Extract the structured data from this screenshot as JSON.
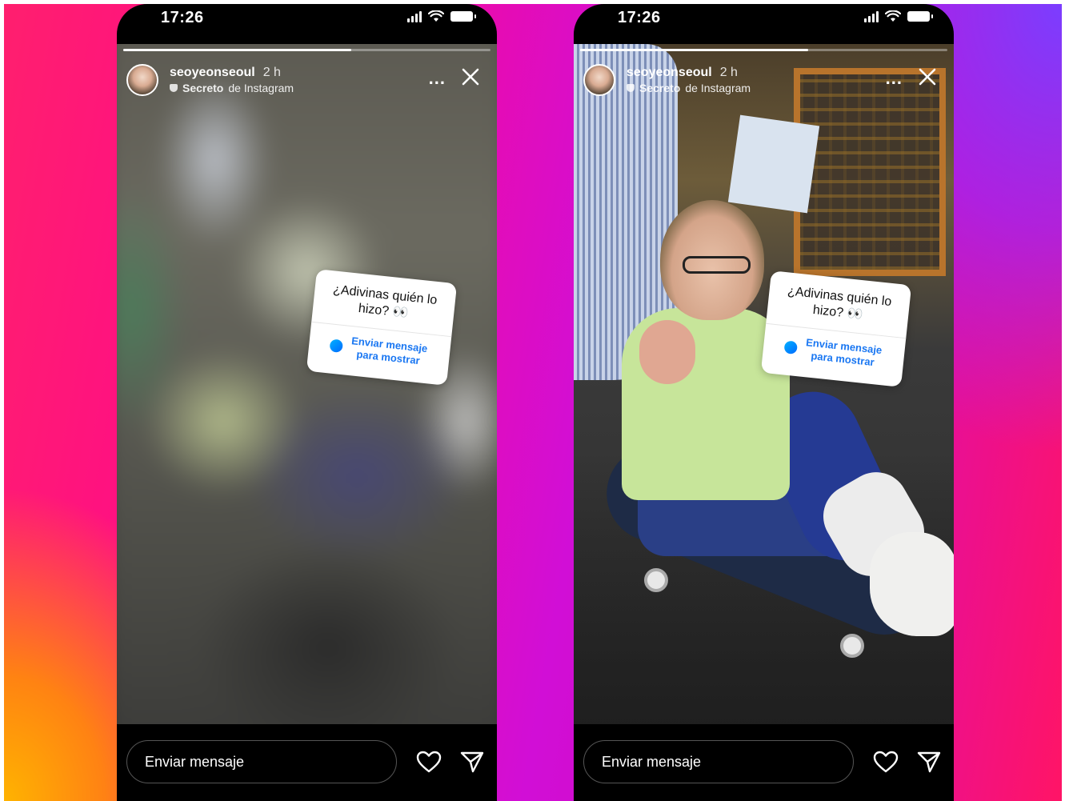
{
  "phones": [
    {
      "status_time": "17:26",
      "username": "seoyeonseoul",
      "time_ago": "2 h",
      "label_strong": "Secreto",
      "label_rest": "de Instagram",
      "more": "...",
      "sticker_question": "¿Adivinas quién lo hizo? 👀",
      "sticker_cta": "Enviar mensaje para mostrar",
      "message_placeholder": "Enviar mensaje",
      "progress": 0.62,
      "media_state": "blurred"
    },
    {
      "status_time": "17:26",
      "username": "seoyeonseoul",
      "time_ago": "2 h",
      "label_strong": "Secreto",
      "label_rest": "de Instagram",
      "more": "...",
      "sticker_question": "¿Adivinas quién lo hizo? 👀",
      "sticker_cta": "Enviar mensaje para mostrar",
      "message_placeholder": "Enviar mensaje",
      "progress": 0.62,
      "media_state": "revealed"
    }
  ],
  "icons": {
    "close": "close-icon",
    "heart": "heart-icon",
    "send": "send-icon",
    "messenger": "messenger-icon",
    "secret": "secret-icon"
  }
}
